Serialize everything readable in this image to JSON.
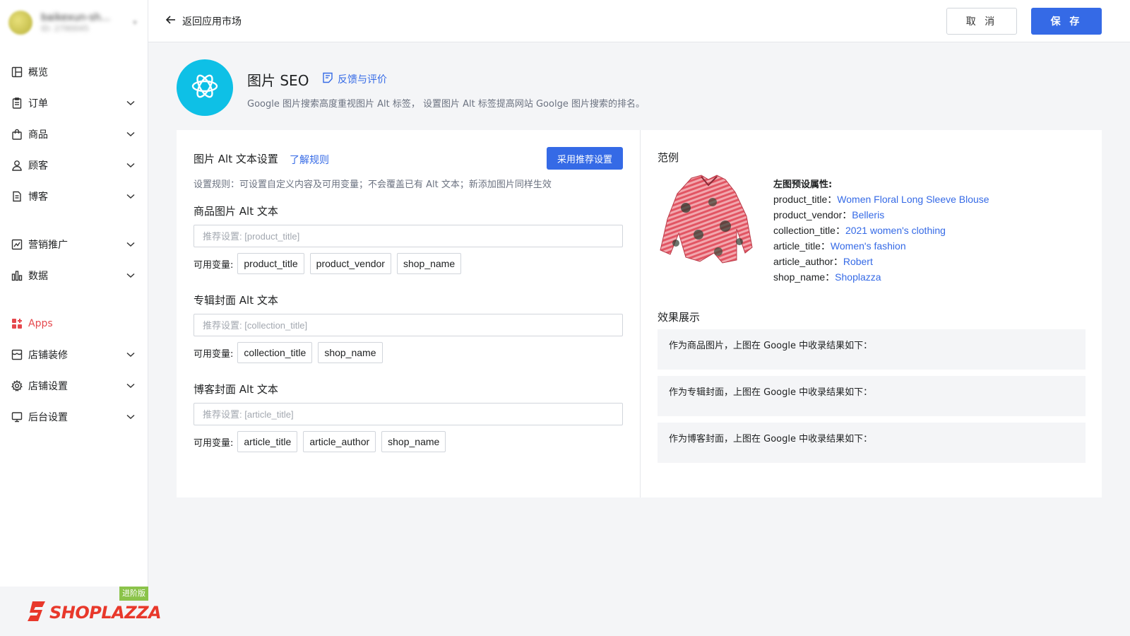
{
  "sidebar": {
    "store": {
      "name": "baikexun-sh...",
      "id": "ID: 2790045"
    },
    "items": [
      {
        "label": "概览",
        "icon": "dashboard-icon",
        "has_caret": false
      },
      {
        "label": "订单",
        "icon": "clipboard-icon",
        "has_caret": true
      },
      {
        "label": "商品",
        "icon": "bag-icon",
        "has_caret": true
      },
      {
        "label": "顾客",
        "icon": "user-icon",
        "has_caret": true
      },
      {
        "label": "博客",
        "icon": "document-icon",
        "has_caret": true
      },
      {
        "label": "营销推广",
        "icon": "marketing-icon",
        "has_caret": true
      },
      {
        "label": "数据",
        "icon": "bar-chart-icon",
        "has_caret": true
      },
      {
        "label": "Apps",
        "icon": "apps-icon",
        "has_caret": false,
        "active": true
      },
      {
        "label": "店铺装修",
        "icon": "storefront-icon",
        "has_caret": true
      },
      {
        "label": "店铺设置",
        "icon": "gear-icon",
        "has_caret": true
      },
      {
        "label": "后台设置",
        "icon": "monitor-icon",
        "has_caret": true
      }
    ],
    "brand": {
      "name": "SHOPLAZZA",
      "badge": "进阶版"
    }
  },
  "topbar": {
    "back_label": "返回应用市场",
    "cancel_label": "取 消",
    "save_label": "保 存"
  },
  "app": {
    "title": "图片 SEO",
    "feedback_label": "反馈与评价",
    "description": "Google 图片搜索高度重视图片 Alt 标签， 设置图片 Alt 标签提高网站 Goolge 图片搜索的排名。"
  },
  "settings": {
    "title": "图片 Alt 文本设置",
    "learn_label": "了解规则",
    "recommend_label": "采用推荐设置",
    "rule_text": "设置规则：可设置自定义内容及可用变量；不会覆盖已有 Alt 文本；新添加图片同样生效",
    "vars_label": "可用变量:",
    "fields": [
      {
        "title": "商品图片 Alt 文本",
        "placeholder": "推荐设置: [product_title]",
        "value": "",
        "vars": [
          "product_title",
          "product_vendor",
          "shop_name"
        ]
      },
      {
        "title": "专辑封面 Alt 文本",
        "placeholder": "推荐设置: [collection_title]",
        "value": "",
        "vars": [
          "collection_title",
          "shop_name"
        ]
      },
      {
        "title": "博客封面 Alt 文本",
        "placeholder": "推荐设置: [article_title]",
        "value": "",
        "vars": [
          "article_title",
          "article_author",
          "shop_name"
        ]
      }
    ]
  },
  "example": {
    "title": "范例",
    "attr_heading": "左图预设属性:",
    "attributes": [
      {
        "key": "product_title：",
        "value": "Women Floral Long Sleeve Blouse"
      },
      {
        "key": "product_vendor：",
        "value": "Belleris"
      },
      {
        "key": "collection_title：",
        "value": "2021 women's clothing"
      },
      {
        "key": "article_title：",
        "value": "Women's fashion"
      },
      {
        "key": "article_author：",
        "value": "Robert"
      },
      {
        "key": "shop_name：",
        "value": "Shoplazza"
      }
    ],
    "effect_title": "效果展示",
    "effects": [
      "作为商品图片，上图在 Google 中收录结果如下：",
      "作为专辑封面，上图在 Google 中收录结果如下：",
      "作为博客封面，上图在 Google 中收录结果如下："
    ]
  },
  "colors": {
    "primary": "#356ae6",
    "accent_red": "#e5484d",
    "app_logo": "#0ec0e6",
    "brand_red": "#e8382b",
    "badge_green": "#8bc34a"
  }
}
